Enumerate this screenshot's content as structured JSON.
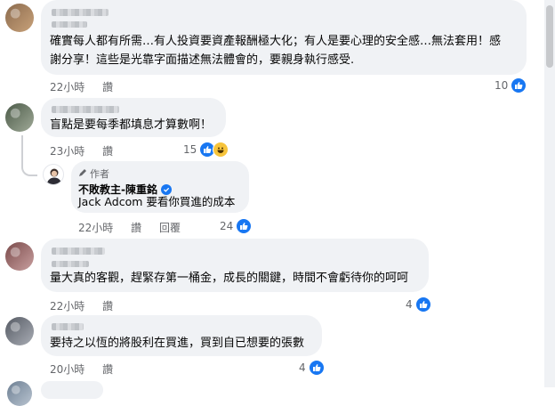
{
  "comments": [
    {
      "text_line1": "確實每人都有所需…有人投資要資產報酬極大化；有人是要心理的安全感…無法套用！感",
      "text_line2": "謝分享！這些是光靠字面描述無法體會的，要親身執行感受.",
      "time": "22小時",
      "reply": "讚",
      "likes": "10"
    },
    {
      "text_line1": "盲點是要每季都填息才算數啊！",
      "time": "23小時",
      "reply": "讚",
      "likes": "15"
    },
    {
      "badge": "作者",
      "author": "不敗教主-陳重銘",
      "text_line1": "Jack Adcom 要看你買進的成本",
      "time": "22小時",
      "reply_like": "讚",
      "reply": "回覆",
      "likes": "24"
    },
    {
      "text_line1": "量大真的客觀，趕緊存第一桶金，成長的關鍵，時間不會虧待你的呵呵",
      "time": "22小時",
      "reply": "讚",
      "likes": "4"
    },
    {
      "text_line1": "要持之以恆的將股利在買進，買到自已想要的張數",
      "time": "20小時",
      "reply": "讚",
      "likes": "4"
    }
  ],
  "colors": {
    "like_blue": "#1877f2",
    "bubble_bg": "#f0f2f5",
    "meta_gray": "#65676b"
  },
  "icons": [
    "like-icon",
    "laugh-reaction-icon",
    "verified-icon",
    "pen-icon"
  ]
}
